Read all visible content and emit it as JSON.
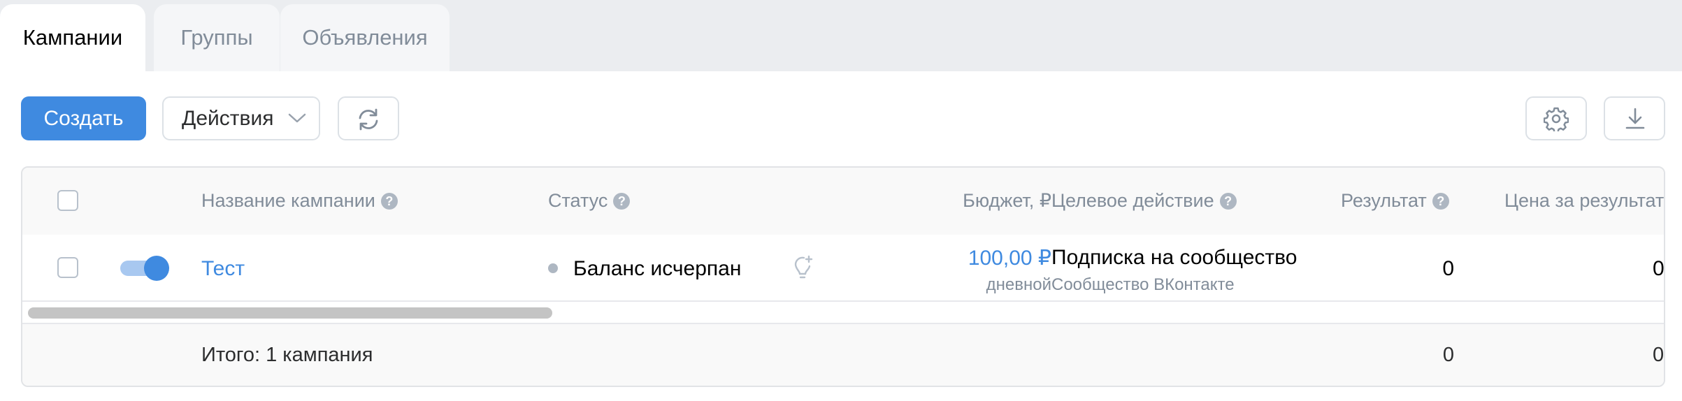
{
  "tabs": [
    {
      "label": "Кампании",
      "active": true
    },
    {
      "label": "Группы",
      "active": false
    },
    {
      "label": "Объявления",
      "active": false
    }
  ],
  "toolbar": {
    "create_label": "Создать",
    "actions_label": "Действия",
    "icons": [
      "chevron-down-icon",
      "refresh-icon",
      "gear-icon",
      "download-icon"
    ]
  },
  "table": {
    "columns": {
      "name": "Название кампании",
      "status": "Статус",
      "budget": "Бюджет, ₽",
      "target": "Целевое действие",
      "result": "Результат",
      "price": "Цена за результат"
    },
    "rows": [
      {
        "enabled": true,
        "name": "Тест",
        "status": "Баланс исчерпан",
        "budget": "100,00 ₽",
        "budget_type": "дневной",
        "target": "Подписка на сообщество",
        "target_sub": "Сообщество ВКонтакте",
        "result": "0",
        "price": "0,"
      }
    ],
    "total": {
      "label": "Итого: 1 кампания",
      "result": "0",
      "price": "0,"
    }
  },
  "colors": {
    "accent": "#3f8ae0",
    "muted": "#818c99",
    "tabbar_bg": "#ebedf0"
  }
}
